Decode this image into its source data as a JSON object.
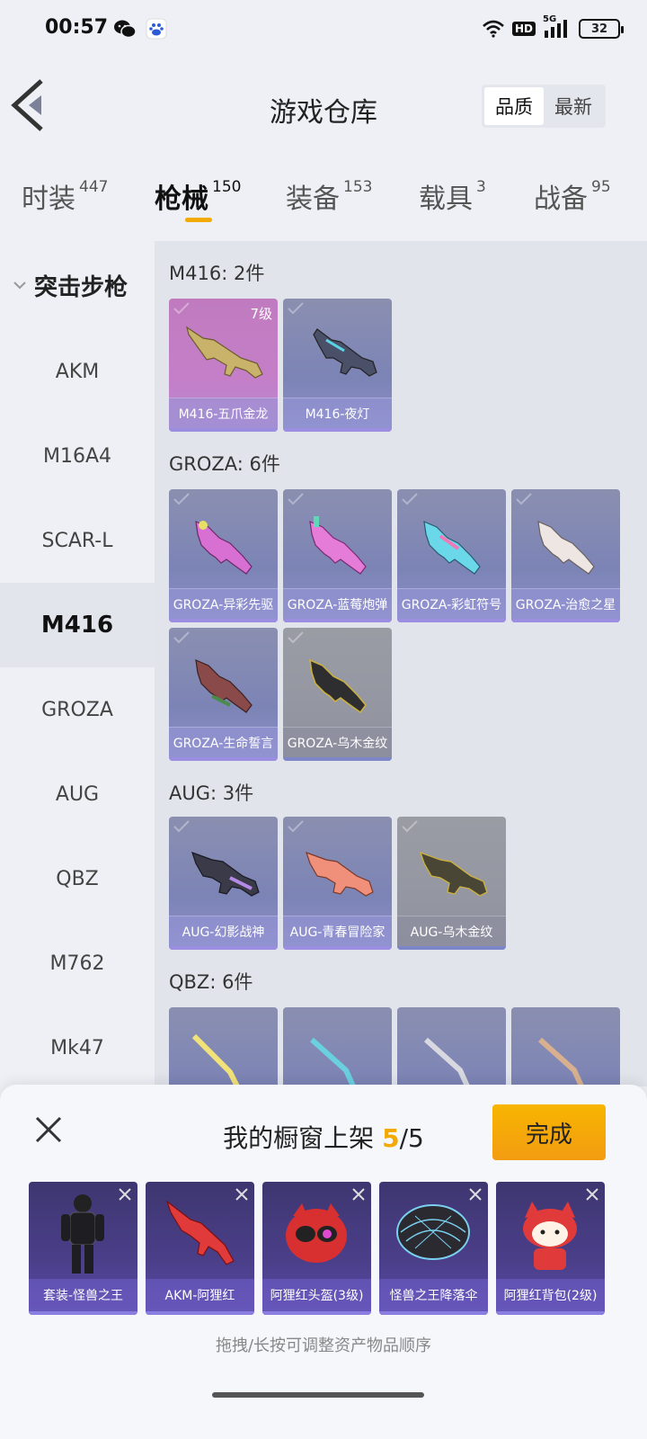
{
  "status": {
    "time": "00:57",
    "network": "5G",
    "hd": "HD",
    "battery": "32"
  },
  "header": {
    "title": "游戏仓库",
    "sort_options": [
      "品质",
      "最新"
    ]
  },
  "tabs": [
    {
      "label": "时装",
      "count": "447"
    },
    {
      "label": "枪械",
      "count": "150"
    },
    {
      "label": "装备",
      "count": "153"
    },
    {
      "label": "载具",
      "count": "3"
    },
    {
      "label": "战备",
      "count": "95"
    }
  ],
  "sidebar": {
    "group": "突击步枪",
    "items": [
      "AKM",
      "M16A4",
      "SCAR-L",
      "M416",
      "GROZA",
      "AUG",
      "QBZ",
      "M762",
      "Mk47"
    ]
  },
  "sections": [
    {
      "title": "M416: 2件",
      "items": [
        {
          "name": "M416-五爪金龙",
          "level": "7级"
        },
        {
          "name": "M416-夜灯"
        }
      ]
    },
    {
      "title": "GROZA: 6件",
      "items": [
        {
          "name": "GROZA-异彩先驱"
        },
        {
          "name": "GROZA-蓝莓炮弹"
        },
        {
          "name": "GROZA-彩虹符号"
        },
        {
          "name": "GROZA-治愈之星"
        },
        {
          "name": "GROZA-生命誓言"
        },
        {
          "name": "GROZA-乌木金纹"
        }
      ]
    },
    {
      "title": "AUG: 3件",
      "items": [
        {
          "name": "AUG-幻影战神"
        },
        {
          "name": "AUG-青春冒险家"
        },
        {
          "name": "AUG-乌木金纹"
        }
      ]
    },
    {
      "title": "QBZ: 6件"
    }
  ],
  "panel": {
    "title": "我的橱窗上架",
    "count_current": "5",
    "count_total": "/5",
    "done_label": "完成",
    "items": [
      "套装-怪兽之王",
      "AKM-阿狸红",
      "阿狸红头盔(3级)",
      "怪兽之王降落伞",
      "阿狸红背包(2级)"
    ],
    "hint": "拖拽/长按可调整资产物品顺序"
  },
  "colors": {
    "accent": "#f2a900",
    "card": "#7c84b6",
    "card_pink": "#c47fc8",
    "card_gray": "#9497a2",
    "showcase": "#4b3f8a"
  }
}
